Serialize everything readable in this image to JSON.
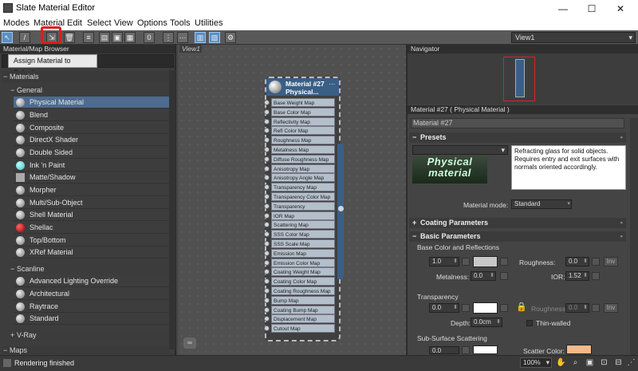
{
  "window": {
    "title": "Slate Material Editor"
  },
  "menu": [
    "Modes",
    "Material",
    "Edit",
    "Select",
    "View",
    "Options",
    "Tools",
    "Utilities"
  ],
  "toolbar": {
    "view_select": "View1",
    "view_slot": "0"
  },
  "browser": {
    "title": "Material/Map Browser",
    "tooltip": "Assign Material to Selection",
    "groups": {
      "materials": "Materials",
      "general": "General",
      "scanline": "Scanline",
      "vray": "V-Ray",
      "maps": "Maps"
    },
    "general_items": [
      "Physical Material",
      "Blend",
      "Composite",
      "DirectX Shader",
      "Double Sided",
      "Ink 'n Paint",
      "Matte/Shadow",
      "Morpher",
      "Multi/Sub-Object",
      "Shell Material",
      "Shellac",
      "Top/Bottom",
      "XRef Material"
    ],
    "scanline_items": [
      "Advanced Lighting Override",
      "Architectural",
      "Raytrace",
      "Standard"
    ]
  },
  "view": {
    "tab": "View1",
    "node_title": "Material #27",
    "node_subtitle": "Physical...",
    "slots": [
      "Base Weight Map",
      "Base Color Map",
      "Reflectivity Map",
      "Refl Color Map",
      "Roughness Map",
      "Metalness Map",
      "Diffuse Roughness Map",
      "Anisotropy Map",
      "Anisotropy Angle Map",
      "Transparency Map",
      "Transparency Color Map",
      "Transparency Roughnes...",
      "IOR Map",
      "Scattering Map",
      "SSS Color Map",
      "SSS Scale Map",
      "Emission Map",
      "Emission Color Map",
      "Coating Weight Map",
      "Coating Color Map",
      "Coating Roughness Map",
      "Bump Map",
      "Coating Bump Map",
      "Displacement Map",
      "Cutout Map"
    ]
  },
  "navigator": {
    "title": "Navigator"
  },
  "properties": {
    "header": "Material #27  ( Physical Material )",
    "name": "Material #27",
    "presets": {
      "title": "Presets",
      "logo": "Physical material",
      "description": "Refracting glass for solid objects. Requires entry and exit surfaces with normals oriented accordingly.",
      "mode_label": "Material mode:",
      "mode_value": "Standard"
    },
    "coating": {
      "title": "Coating Parameters"
    },
    "basic": {
      "title": "Basic Parameters",
      "base_section": "Base Color and Reflections",
      "base_weight": "1.0",
      "roughness_label": "Roughness:",
      "roughness": "0.0",
      "inv": "Inv",
      "metalness_label": "Metalness:",
      "metalness": "0.0",
      "ior_label": "IOR:",
      "ior": "1.52",
      "transparency_section": "Transparency",
      "trans_weight": "0.0",
      "trans_roughness_label": "Roughness:",
      "trans_roughness": "0.0",
      "depth_label": "Depth:",
      "depth": "0.0cm",
      "thin_walled": "Thin-walled",
      "sss_section": "Sub-Surface Scattering",
      "sss_weight": "0.0",
      "scatter_label": "Scatter Color:"
    }
  },
  "status": {
    "text": "Rendering finished",
    "zoom": "100%"
  },
  "colors": {
    "base": "#c8c8c8",
    "transparency": "#ffffff",
    "scatter": "#f6b98a",
    "node_header": "#3a5f86",
    "selection": "#4d6b8e"
  }
}
